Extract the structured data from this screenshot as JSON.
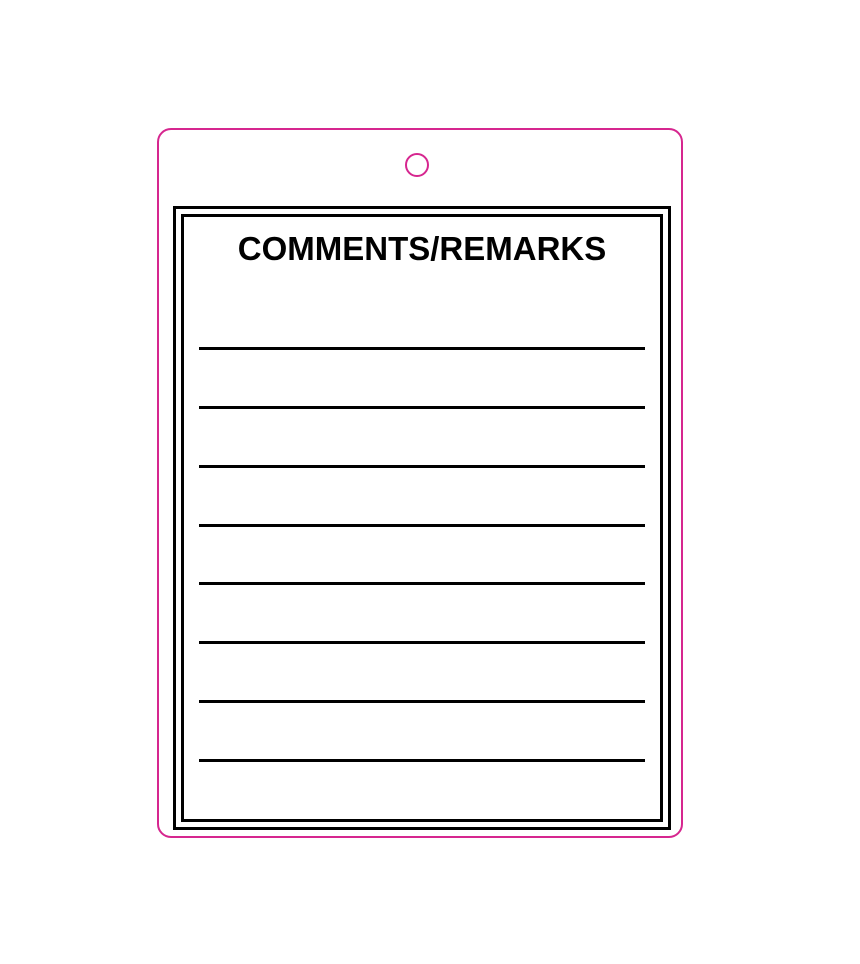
{
  "tag": {
    "title": "COMMENTS/REMARKS",
    "line_count": 8,
    "border_color": "#d6268f"
  }
}
